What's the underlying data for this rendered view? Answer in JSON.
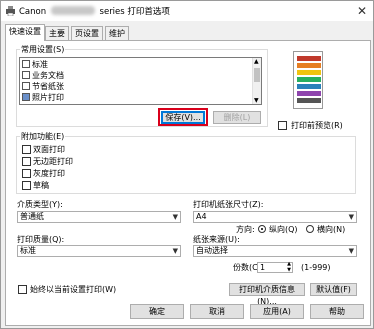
{
  "window": {
    "title_brand": "Canon",
    "title_suffix": "series 打印首选项",
    "close_icon": "close-icon"
  },
  "tabs": [
    {
      "label": "快速设置",
      "active": true
    },
    {
      "label": "主要",
      "active": false
    },
    {
      "label": "页设置",
      "active": false
    },
    {
      "label": "维护",
      "active": false
    }
  ],
  "common_settings": {
    "label": "常用设置(S)",
    "items": [
      "标准",
      "业务文档",
      "节省纸张",
      "照片打印"
    ],
    "save_button": "保存(V)...",
    "delete_button": "删除(L)"
  },
  "preview_checkbox": "打印前预览(R)",
  "additional_features": {
    "label": "附加功能(E)",
    "items": [
      "双面打印",
      "无边距打印",
      "灰度打印",
      "草稿"
    ]
  },
  "media_type": {
    "label": "介质类型(Y):",
    "value": "普通纸"
  },
  "paper_size": {
    "label": "打印机纸张尺寸(Z):",
    "value": "A4"
  },
  "orientation": {
    "label": "方向:",
    "portrait": "纵向(Q)",
    "landscape": "横向(N)"
  },
  "print_quality": {
    "label": "打印质量(Q):",
    "value": "标准"
  },
  "paper_source": {
    "label": "纸张来源(U):",
    "value": "自动选择"
  },
  "copies": {
    "label": "份数(C):",
    "value": "1",
    "range": "(1-999)"
  },
  "always_print_checkbox": "始终以当前设置打印(W)",
  "media_info_button": "打印机介质信息(N)...",
  "defaults_button": "默认值(F)",
  "footer": {
    "ok": "确定",
    "cancel": "取消",
    "apply": "应用(A)",
    "help": "帮助"
  },
  "colors": {
    "accent": "#0078d7",
    "highlight_box": "#d9001b"
  }
}
